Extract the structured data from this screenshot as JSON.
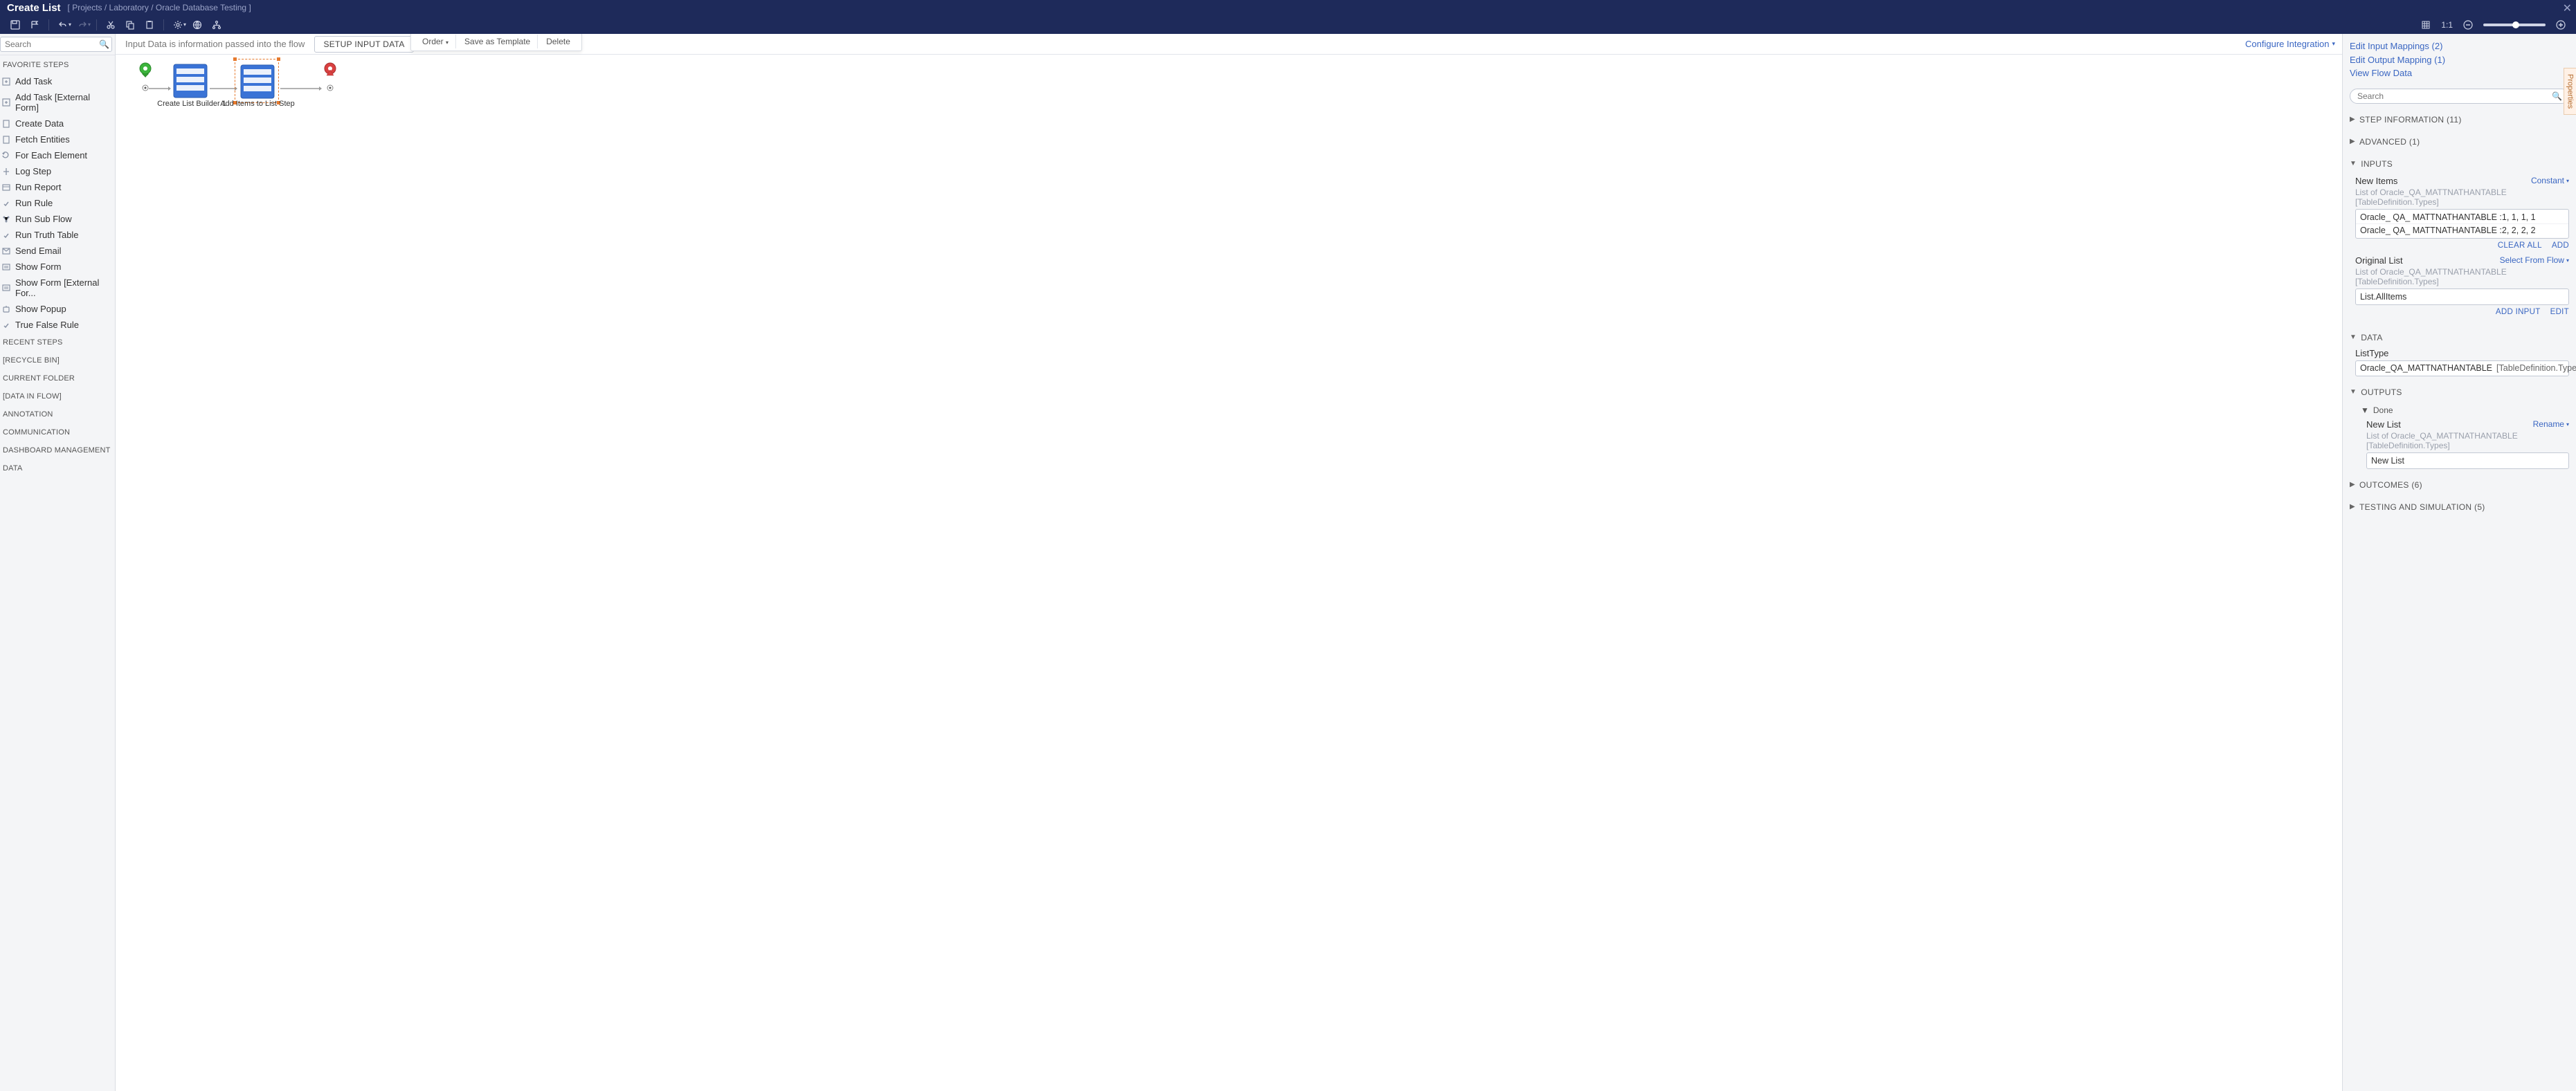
{
  "header": {
    "title": "Create List",
    "breadcrumb": "[ Projects / Laboratory / Oracle Database Testing ]"
  },
  "toolbar": {
    "zoom_ratio": "1:1"
  },
  "subheader": {
    "hint": "Input Data is information passed into the flow",
    "setup_btn": "SETUP INPUT DATA",
    "menu_order": "Order",
    "menu_save_template": "Save as Template",
    "menu_delete": "Delete",
    "configure": "Configure Integration"
  },
  "left": {
    "search_placeholder": "Search",
    "favorite_header": "FAVORITE STEPS",
    "favorites": [
      "Add Task",
      "Add Task [External Form]",
      "Create Data",
      "Fetch Entities",
      "For Each Element",
      "Log Step",
      "Run Report",
      "Run Rule",
      "Run Sub Flow",
      "Run Truth Table",
      "Send Email",
      "Show Form",
      "Show Form [External For...",
      "Show Popup",
      "True False Rule"
    ],
    "recent_header": "RECENT STEPS",
    "recycle_header": "[RECYCLE BIN]",
    "current_header": "CURRENT FOLDER",
    "data_in_flow_header": "[DATA IN FLOW]",
    "annotation_header": "ANNOTATION",
    "communication_header": "COMMUNICATION",
    "dashboard_header": "DASHBOARD MANAGEMENT",
    "data_header": "DATA"
  },
  "flow": {
    "node1": "Create List Builder 1",
    "node2": "Add Items to List Step"
  },
  "right": {
    "links": {
      "edit_inputs": "Edit Input Mappings (2)",
      "edit_output": "Edit Output Mapping (1)",
      "view_flow_data": "View Flow Data"
    },
    "search_placeholder": "Search",
    "sections": {
      "step_info": "STEP INFORMATION (11)",
      "advanced": "ADVANCED (1)",
      "inputs": "INPUTS",
      "data": "DATA",
      "outputs": "OUTPUTS",
      "outcomes": "OUTCOMES (6)",
      "testing": "TESTING AND SIMULATION (5)"
    },
    "inputs": {
      "new_items_label": "New Items",
      "new_items_mode": "Constant",
      "new_items_type": "List of Oracle_QA_MATTNATHANTABLE [TableDefinition.Types]",
      "new_items_values": [
        "Oracle_ QA_ MATTNATHANTABLE :1, 1, 1, 1",
        "Oracle_ QA_ MATTNATHANTABLE :2, 2, 2, 2"
      ],
      "clear_all": "CLEAR ALL",
      "add": "ADD",
      "original_list_label": "Original List",
      "original_list_mode": "Select From Flow",
      "original_list_type": "List of Oracle_QA_MATTNATHANTABLE [TableDefinition.Types]",
      "original_list_value": "List.AllItems",
      "add_input": "ADD INPUT",
      "edit": "EDIT"
    },
    "data": {
      "listtype_label": "ListType",
      "listtype_value": "Oracle_QA_MATTNATHANTABLE",
      "listtype_tag": "[TableDefinition.Types]"
    },
    "outputs": {
      "done_label": "Done",
      "newlist_label": "New List",
      "rename": "Rename",
      "newlist_type": "List of Oracle_QA_MATTNATHANTABLE [TableDefinition.Types]",
      "newlist_value": "New List"
    }
  },
  "prop_tab": "Properties"
}
